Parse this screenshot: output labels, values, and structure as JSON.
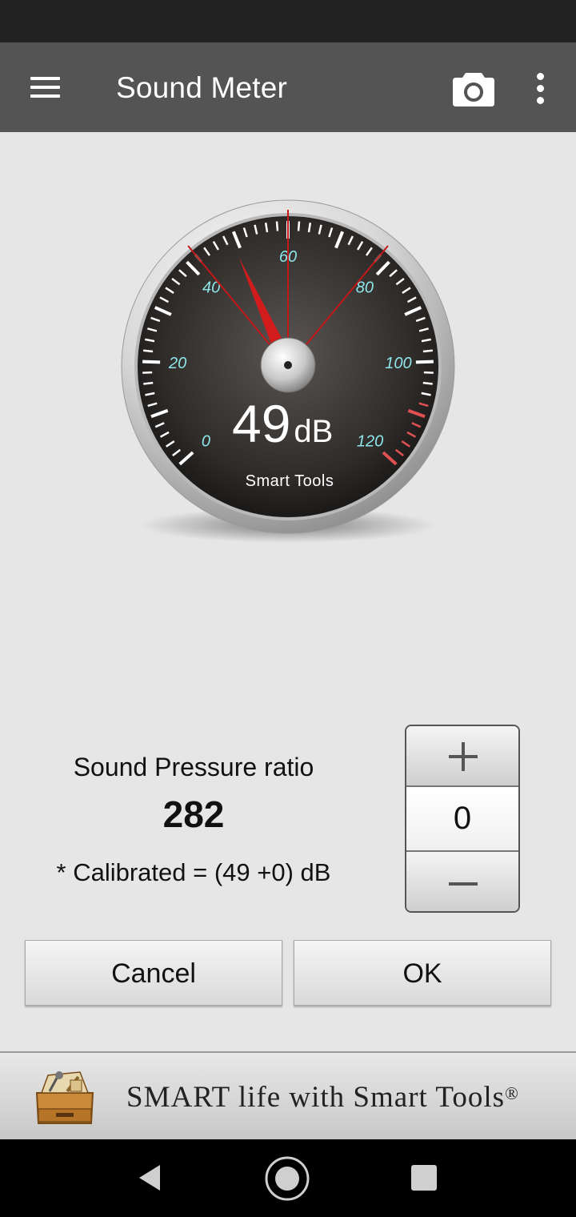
{
  "app_bar": {
    "title": "Sound Meter",
    "icons": [
      "menu-icon",
      "camera-icon",
      "more-vert-icon"
    ]
  },
  "gauge": {
    "reading": "49",
    "unit": "dB",
    "brand": "Smart Tools",
    "scale_labels": [
      "0",
      "20",
      "40",
      "60",
      "80",
      "100",
      "120"
    ],
    "scale_min": 0,
    "scale_max": 120,
    "needle_value": 49,
    "marker_values": [
      42,
      60,
      78
    ],
    "accent_colors": {
      "label": "#8ee6ea",
      "needle": "#d21c1c",
      "marker": "#c41818",
      "danger_ticks": "#e05050"
    }
  },
  "calibration": {
    "ratio_label": "Sound Pressure ratio",
    "ratio_value": "282",
    "calibrated_text": "* Calibrated = (49 +0) dB",
    "offset_value": "0"
  },
  "buttons": {
    "cancel": "Cancel",
    "ok": "OK"
  },
  "footer": {
    "slogan": "SMART life with Smart Tools",
    "registered": "®"
  },
  "nav": {
    "icons": [
      "back-icon",
      "home-icon",
      "recent-apps-icon"
    ]
  }
}
